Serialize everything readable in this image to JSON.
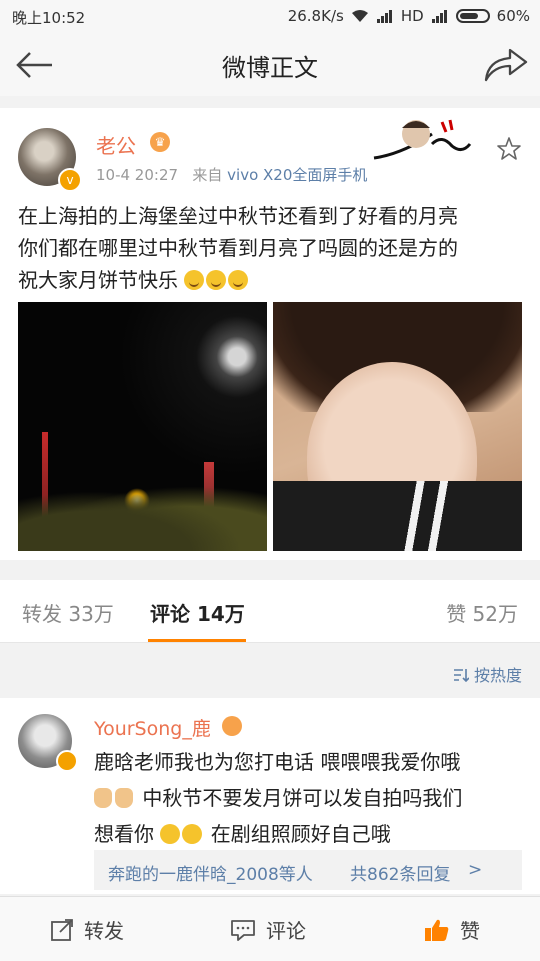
{
  "status": {
    "time": "晚上10:52",
    "speed": "26.8K/s",
    "network": "HD",
    "battery": "60%"
  },
  "nav": {
    "title": "微博正文"
  },
  "post": {
    "username": "老公",
    "time": "10-4 20:27",
    "source_prefix": "来自",
    "source": "vivo X20全面屏手机",
    "lines": [
      "在上海拍的上海堡垒过中秋节还看到了好看的月亮",
      "你们都在哪里过中秋节看到月亮了吗圆的还是方的",
      "祝大家月饼节快乐"
    ]
  },
  "stats": {
    "repost": "转发 33万",
    "comment": "评论 14万",
    "like": "赞 52万"
  },
  "sort": {
    "label": "按热度"
  },
  "comment": {
    "username": "YourSong_鹿",
    "line1": "鹿晗老师我也为您打电话 喂喂喂我爱你哦",
    "line2": "中秋节不要发月饼可以发自拍吗我们",
    "line3_a": "想看你",
    "line3_b": "在剧组照顾好自己哦",
    "replies_users": "奔跑的一鹿伴晗_2008等人",
    "replies_count": "共862条回复",
    "replies_arrow": ">"
  },
  "bottom": {
    "repost": "转发",
    "comment": "评论",
    "like": "赞"
  },
  "colors": {
    "accent": "#ff8200",
    "username": "#eb7350",
    "link": "#5d7fa8"
  }
}
